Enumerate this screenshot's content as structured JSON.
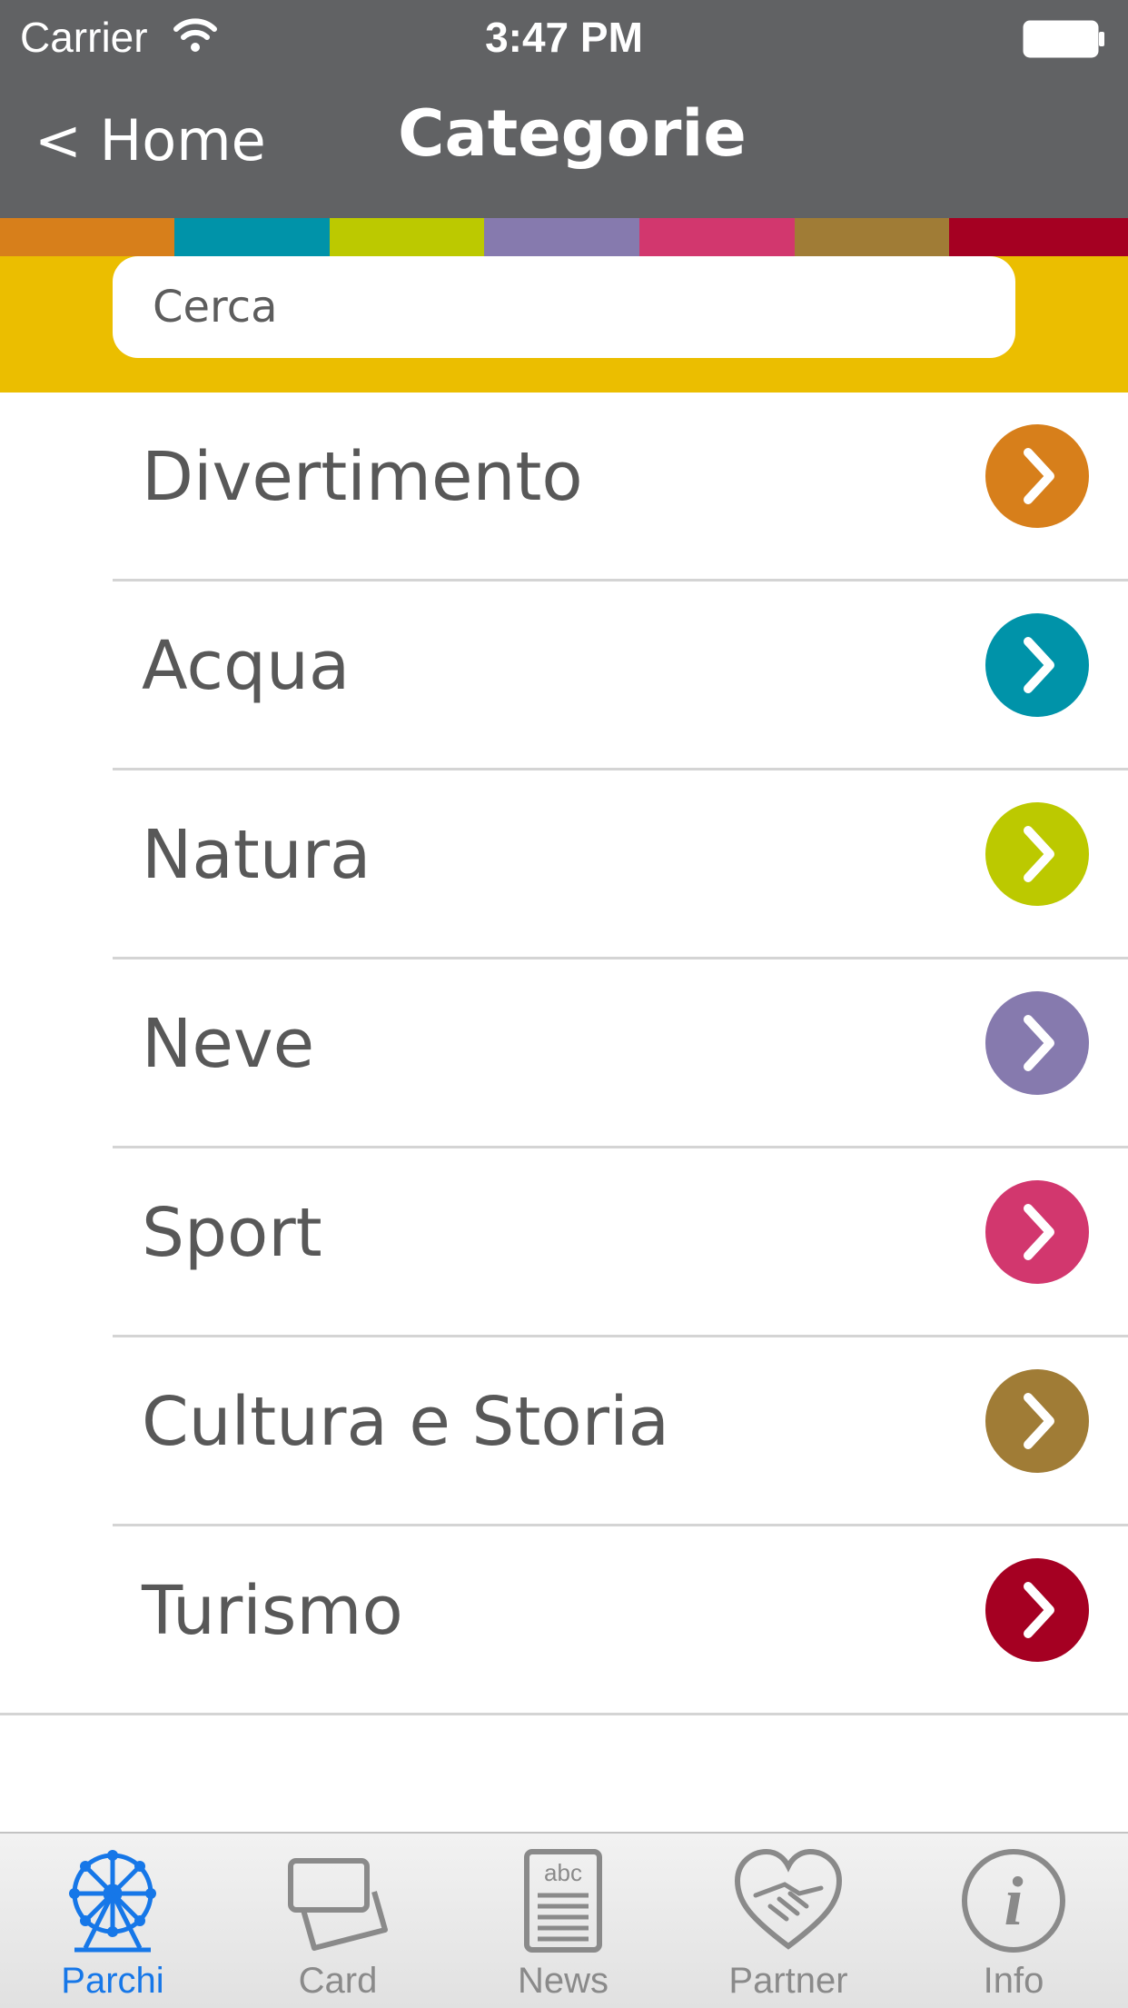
{
  "status_bar": {
    "carrier": "Carrier",
    "time": "3:47 PM"
  },
  "nav": {
    "back_label": "< Home",
    "title": "Categorie"
  },
  "color_strip": [
    "#d77f1b",
    "#0093a9",
    "#bcc900",
    "#867aae",
    "#d2376e",
    "#a07c36",
    "#a50022"
  ],
  "search": {
    "placeholder": "Cerca"
  },
  "categories": [
    {
      "label": "Divertimento",
      "color": "#d77f1b"
    },
    {
      "label": "Acqua",
      "color": "#0093a9"
    },
    {
      "label": "Natura",
      "color": "#bcc900"
    },
    {
      "label": "Neve",
      "color": "#867aae"
    },
    {
      "label": "Sport",
      "color": "#d2376e"
    },
    {
      "label": "Cultura e Storia",
      "color": "#a07c36"
    },
    {
      "label": "Turismo",
      "color": "#a50022"
    }
  ],
  "tabs": [
    {
      "label": "Parchi",
      "icon": "ferris-wheel-icon",
      "active": true
    },
    {
      "label": "Card",
      "icon": "cards-icon",
      "active": false
    },
    {
      "label": "News",
      "icon": "newspaper-icon",
      "active": false
    },
    {
      "label": "Partner",
      "icon": "handshake-icon",
      "active": false
    },
    {
      "label": "Info",
      "icon": "info-icon",
      "active": false
    }
  ],
  "colors": {
    "header_bg": "#616264",
    "search_band": "#ebbe00",
    "tab_active": "#1677e8",
    "tab_inactive": "#8a8a8a"
  }
}
